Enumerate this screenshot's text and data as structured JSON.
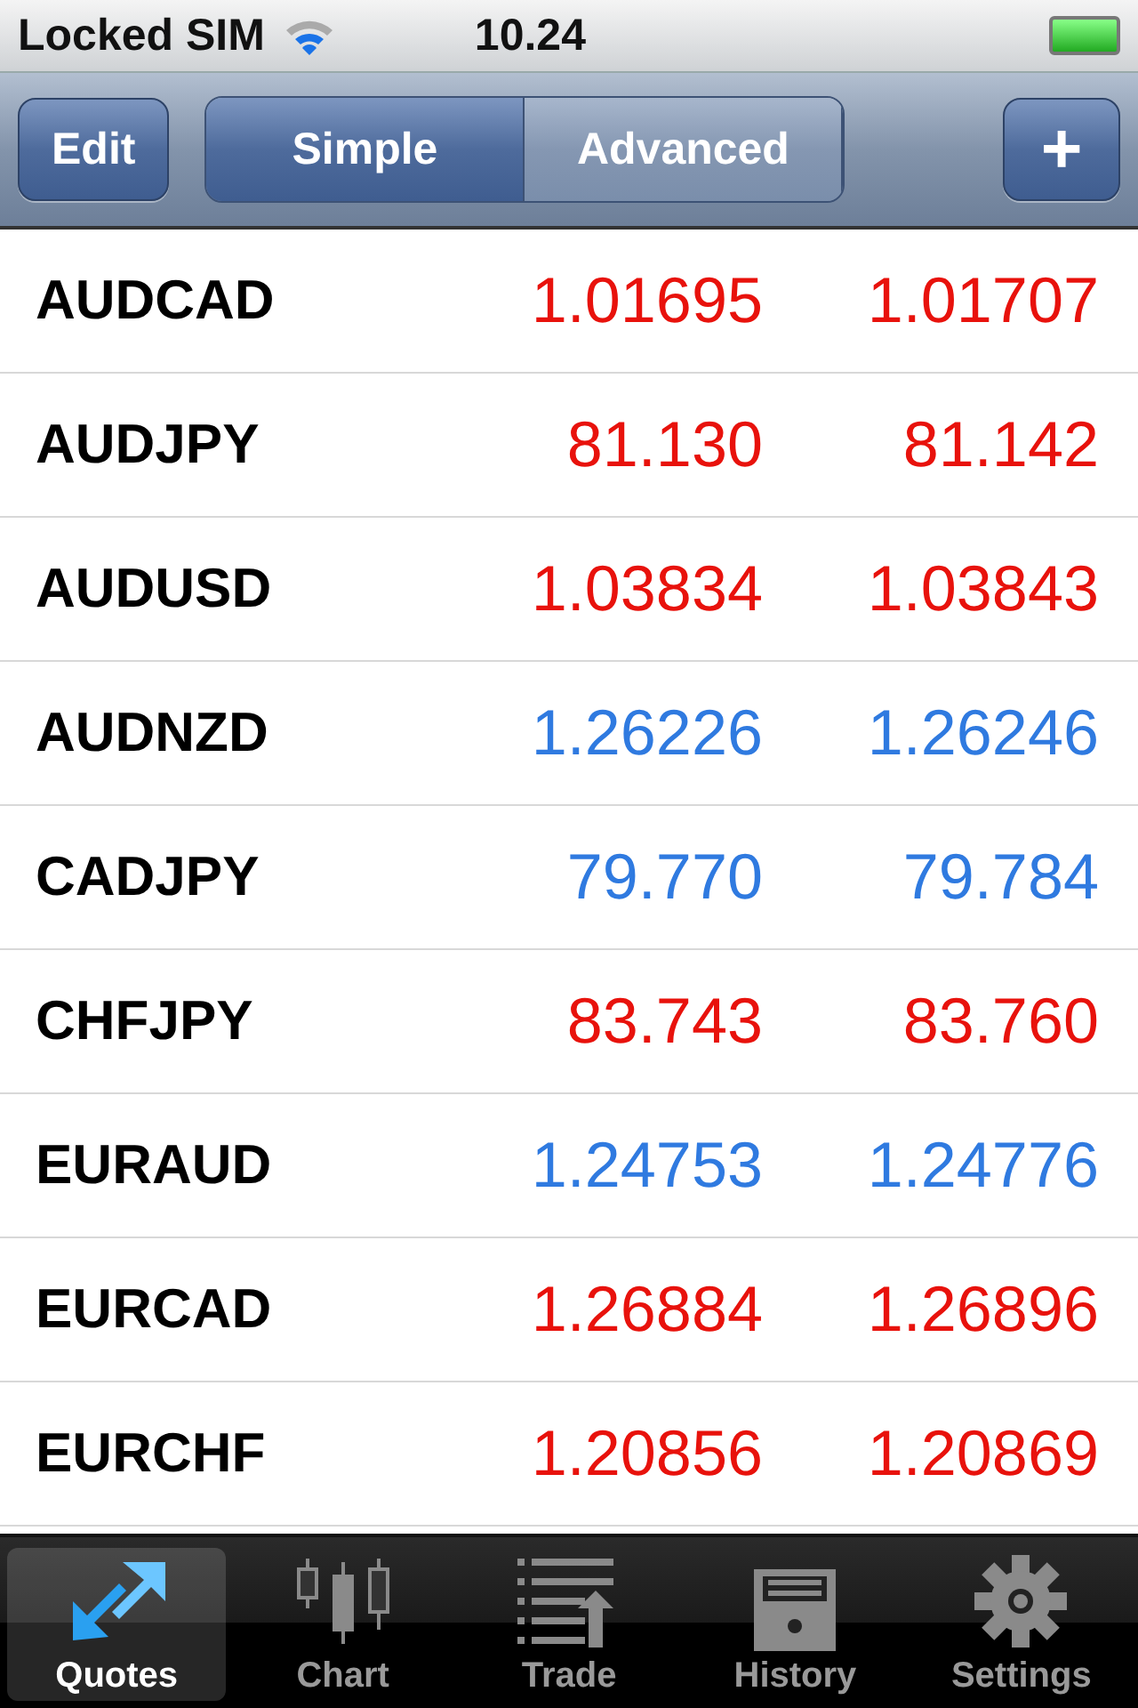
{
  "status_bar": {
    "carrier": "Locked SIM",
    "time": "10.24"
  },
  "nav_bar": {
    "edit": "Edit",
    "segments": [
      {
        "label": "Simple",
        "selected": true
      },
      {
        "label": "Advanced",
        "selected": false
      }
    ],
    "add": "+"
  },
  "quotes": [
    {
      "symbol": "AUDCAD",
      "bid": "1.01695",
      "ask": "1.01707",
      "color": "#e8120c"
    },
    {
      "symbol": "AUDJPY",
      "bid": "81.130",
      "ask": "81.142",
      "color": "#e8120c"
    },
    {
      "symbol": "AUDUSD",
      "bid": "1.03834",
      "ask": "1.03843",
      "color": "#e8120c"
    },
    {
      "symbol": "AUDNZD",
      "bid": "1.26226",
      "ask": "1.26246",
      "color": "#2f7ae0"
    },
    {
      "symbol": "CADJPY",
      "bid": "79.770",
      "ask": "79.784",
      "color": "#2f7ae0"
    },
    {
      "symbol": "CHFJPY",
      "bid": "83.743",
      "ask": "83.760",
      "color": "#e8120c"
    },
    {
      "symbol": "EURAUD",
      "bid": "1.24753",
      "ask": "1.24776",
      "color": "#2f7ae0"
    },
    {
      "symbol": "EURCAD",
      "bid": "1.26884",
      "ask": "1.26896",
      "color": "#e8120c"
    },
    {
      "symbol": "EURCHF",
      "bid": "1.20856",
      "ask": "1.20869",
      "color": "#e8120c"
    }
  ],
  "tab_bar": [
    {
      "label": "Quotes",
      "kind": "quotes",
      "selected": true
    },
    {
      "label": "Chart",
      "kind": "chart",
      "selected": false
    },
    {
      "label": "Trade",
      "kind": "trade",
      "selected": false
    },
    {
      "label": "History",
      "kind": "history",
      "selected": false
    },
    {
      "label": "Settings",
      "kind": "settings",
      "selected": false
    }
  ]
}
